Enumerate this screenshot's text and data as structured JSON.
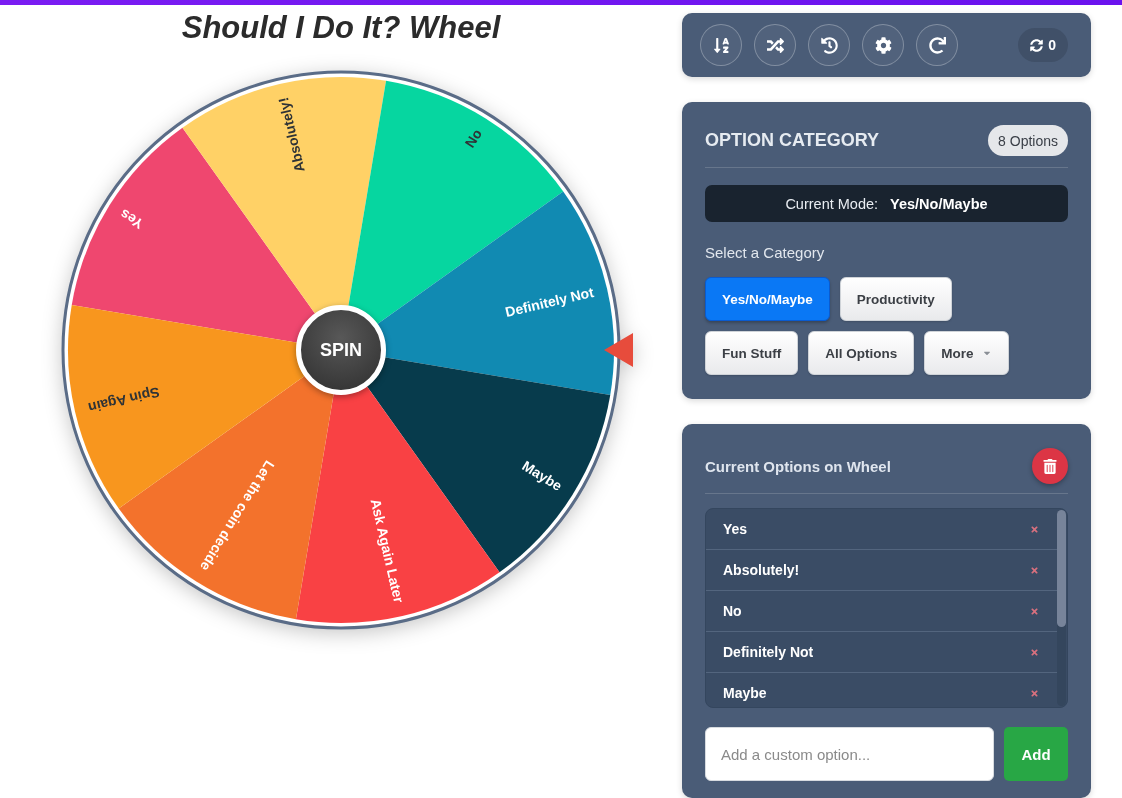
{
  "title": "Should I Do It? Wheel",
  "wheel": {
    "spin_button": "SPIN",
    "segments": [
      {
        "label": "Yes",
        "color": "#ef476f"
      },
      {
        "label": "Absolutely!",
        "color": "#ffd166"
      },
      {
        "label": "No",
        "color": "#06d6a0"
      },
      {
        "label": "Definitely Not",
        "color": "#118ab2"
      },
      {
        "label": "Maybe",
        "color": "#073b4c"
      },
      {
        "label": "Ask Again Later",
        "color": "#f94144"
      },
      {
        "label": "Let the coin decide",
        "color": "#f3722c"
      },
      {
        "label": "Spin Again",
        "color": "#f8961e"
      }
    ]
  },
  "toolbar": {
    "spin_count": "0"
  },
  "category_panel": {
    "title": "OPTION CATEGORY",
    "count_badge": "8 Options",
    "mode_label": "Current Mode:",
    "mode_value": "Yes/No/Maybe",
    "select_label": "Select a Category",
    "categories": [
      {
        "label": "Yes/No/Maybe",
        "kind": "category",
        "selected": true
      },
      {
        "label": "Productivity",
        "kind": "category",
        "selected": false
      },
      {
        "label": "Fun Stuff",
        "kind": "category",
        "selected": false
      },
      {
        "label": "All Options",
        "kind": "category",
        "selected": false
      },
      {
        "label": "More",
        "kind": "dropdown",
        "selected": false
      }
    ]
  },
  "options_panel": {
    "title": "Current Options on Wheel",
    "items": [
      {
        "label": "Yes"
      },
      {
        "label": "Absolutely!"
      },
      {
        "label": "No"
      },
      {
        "label": "Definitely Not"
      },
      {
        "label": "Maybe"
      }
    ],
    "input": {
      "placeholder": "Add a custom option..."
    },
    "add_button": "Add"
  }
}
